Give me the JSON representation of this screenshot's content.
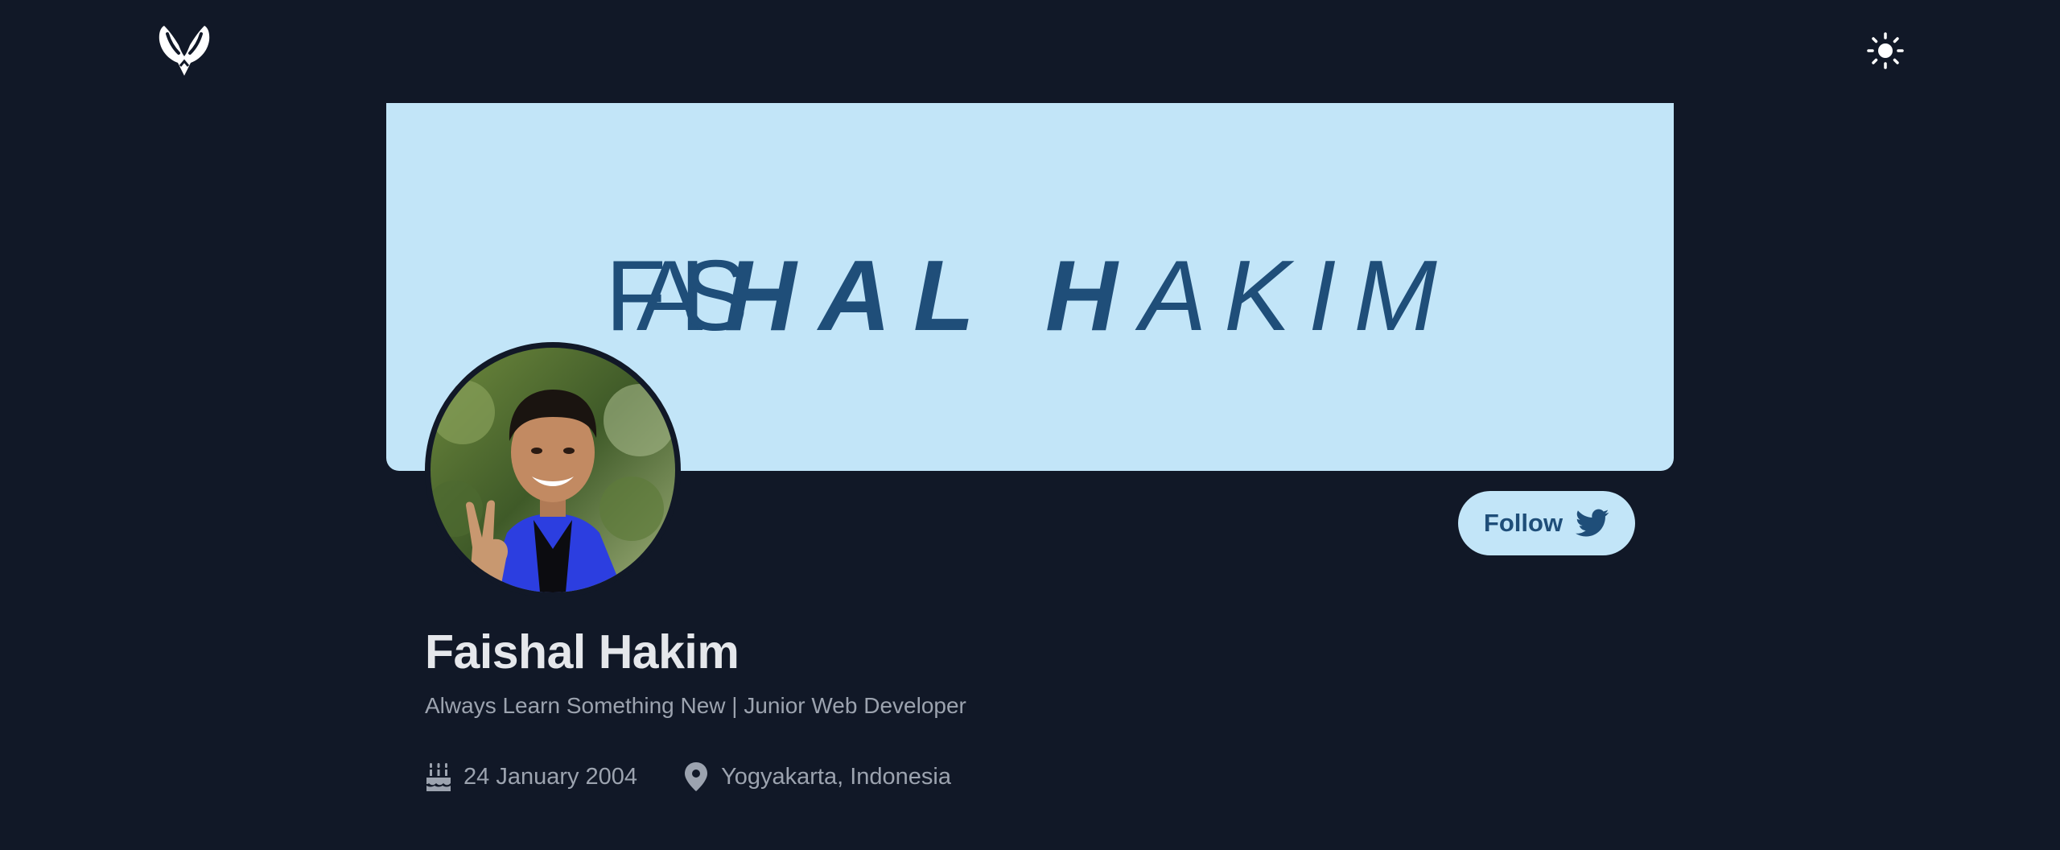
{
  "header": {
    "logo_icon": "winged-heart-logo-icon",
    "theme_toggle_icon": "sun-icon"
  },
  "banner": {
    "segments": [
      {
        "text": "FAIS",
        "style": "light"
      },
      {
        "text": "HAL H",
        "style": "bold"
      },
      {
        "text": "AKIM",
        "style": "light"
      }
    ],
    "background_color": "#c2e5f8",
    "text_color": "#1f4e79"
  },
  "profile": {
    "avatar_alt": "profile-photo",
    "name": "Faishal Hakim",
    "tagline": "Always Learn Something New | Junior Web Developer",
    "birthday": "24 January 2004",
    "location": "Yogyakarta, Indonesia"
  },
  "actions": {
    "follow_label": "Follow",
    "follow_icon": "twitter-bird-icon"
  },
  "colors": {
    "background": "#111827",
    "accent": "#c2e5f8",
    "accent_text": "#1f4e79",
    "heading": "#e5e7eb",
    "muted": "#9ca3af"
  }
}
